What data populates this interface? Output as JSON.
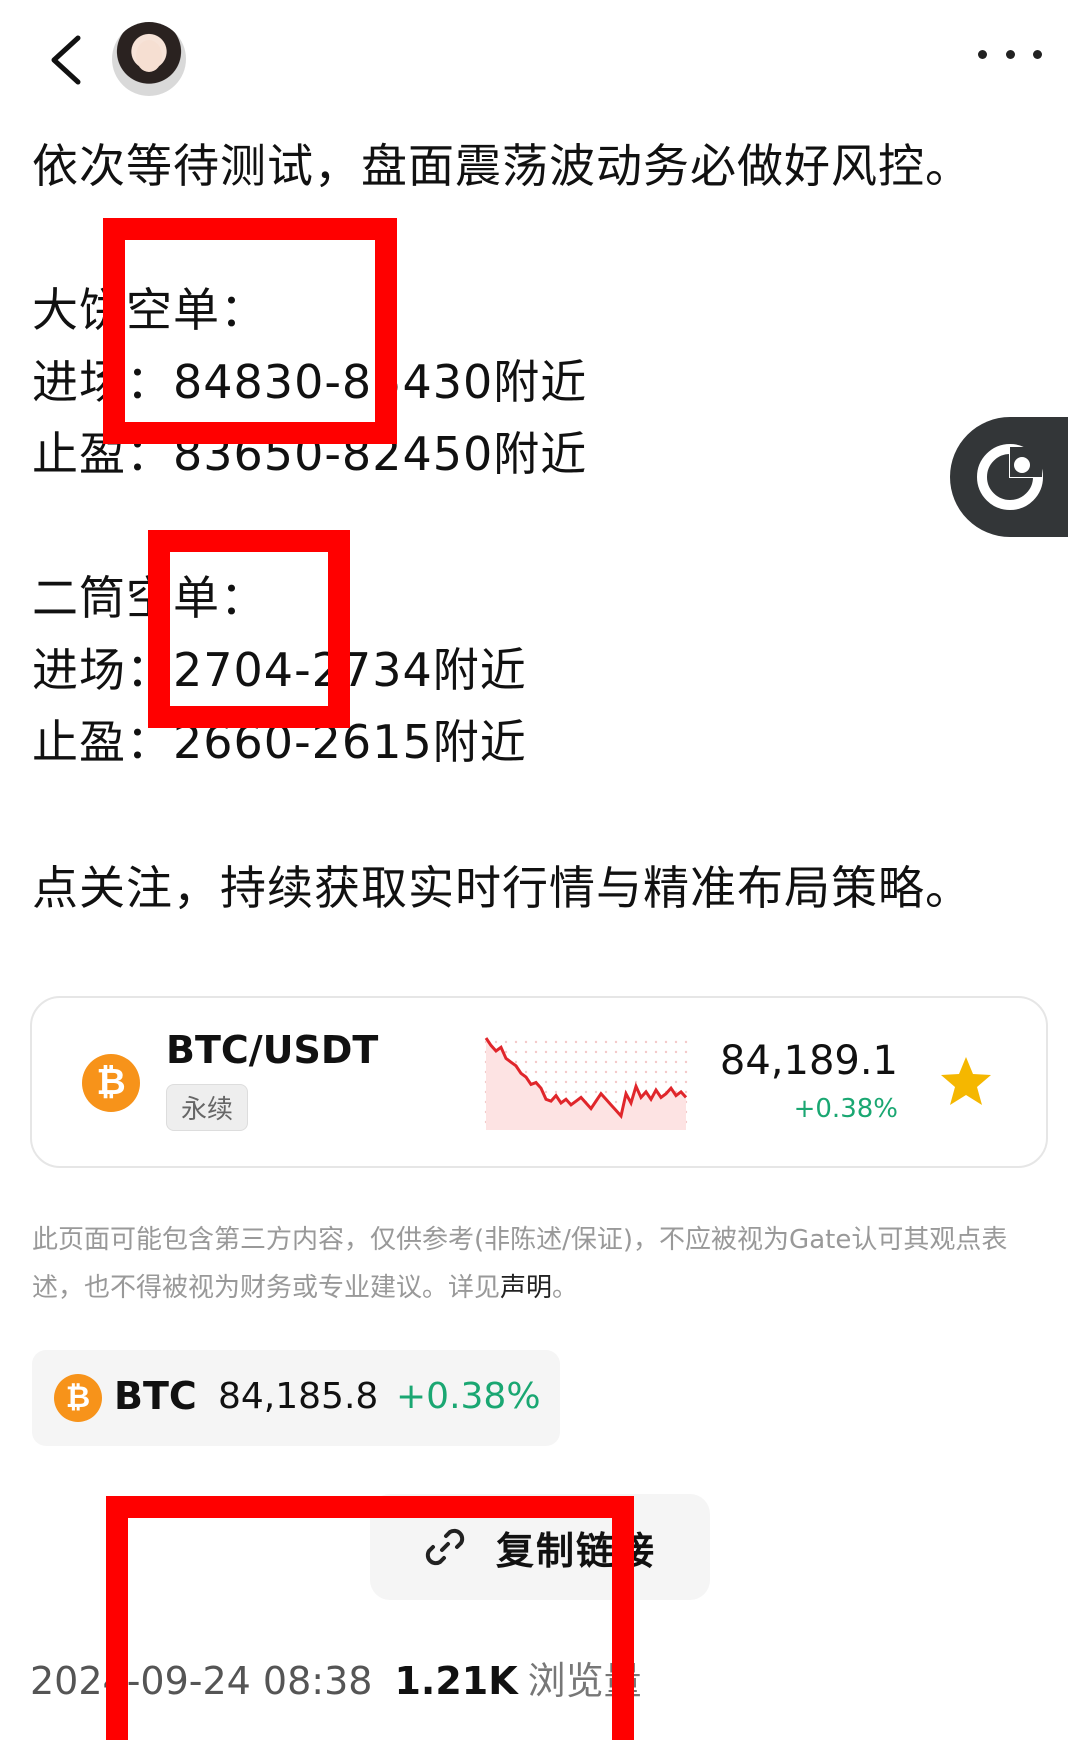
{
  "header": {
    "back_icon": "chevron-left-icon",
    "avatar_icon": "user-avatar",
    "more_icon": "more-dots-icon"
  },
  "post": {
    "lines": [
      "依次等待测试，盘面震荡波动务必做好风控。",
      "大饼空单：",
      "进场：84830-85430附近",
      "止盈：83650-82450附近",
      "二筒空单：",
      "进场：2704-2734附近",
      "止盈：2660-2615附近",
      "点关注，持续获取实时行情与精准布局策略。"
    ]
  },
  "market_card": {
    "pair": "BTC/USDT",
    "tag": "永续",
    "price": "84,189.1",
    "change": "+0.38%",
    "coin_icon_glyph": "₿",
    "favorite_icon": "star-icon",
    "colors": {
      "up": "#1aa772",
      "chart_red": "#e0262b",
      "btc": "#f7931a",
      "star": "#f5b700"
    }
  },
  "sparkline": [
    20,
    28,
    34,
    30,
    42,
    46,
    50,
    58,
    62,
    70,
    68,
    74,
    86,
    88,
    82,
    90,
    86,
    92,
    88,
    84,
    90,
    96,
    88,
    80,
    86,
    92,
    98,
    104,
    80,
    90,
    72,
    84,
    78,
    86,
    76,
    84,
    80,
    74,
    82,
    78,
    84
  ],
  "disclaimer": {
    "text": "此页面可能包含第三方内容，仅供参考(非陈述/保证)，不应被视为Gate认可其观点表述，也不得被视为财务或专业建议。详见",
    "link": "声明",
    "suffix": "。"
  },
  "coin_chip": {
    "symbol": "BTC",
    "price": "84,185.8",
    "change": "+0.38%"
  },
  "copy_link": {
    "label": "复制链接",
    "icon": "link-icon"
  },
  "meta": {
    "datetime": "2024-09-24 08:38",
    "views": "1.21K",
    "views_label": "浏览量"
  },
  "float_button": {
    "icon": "refresh-circle-icon"
  }
}
